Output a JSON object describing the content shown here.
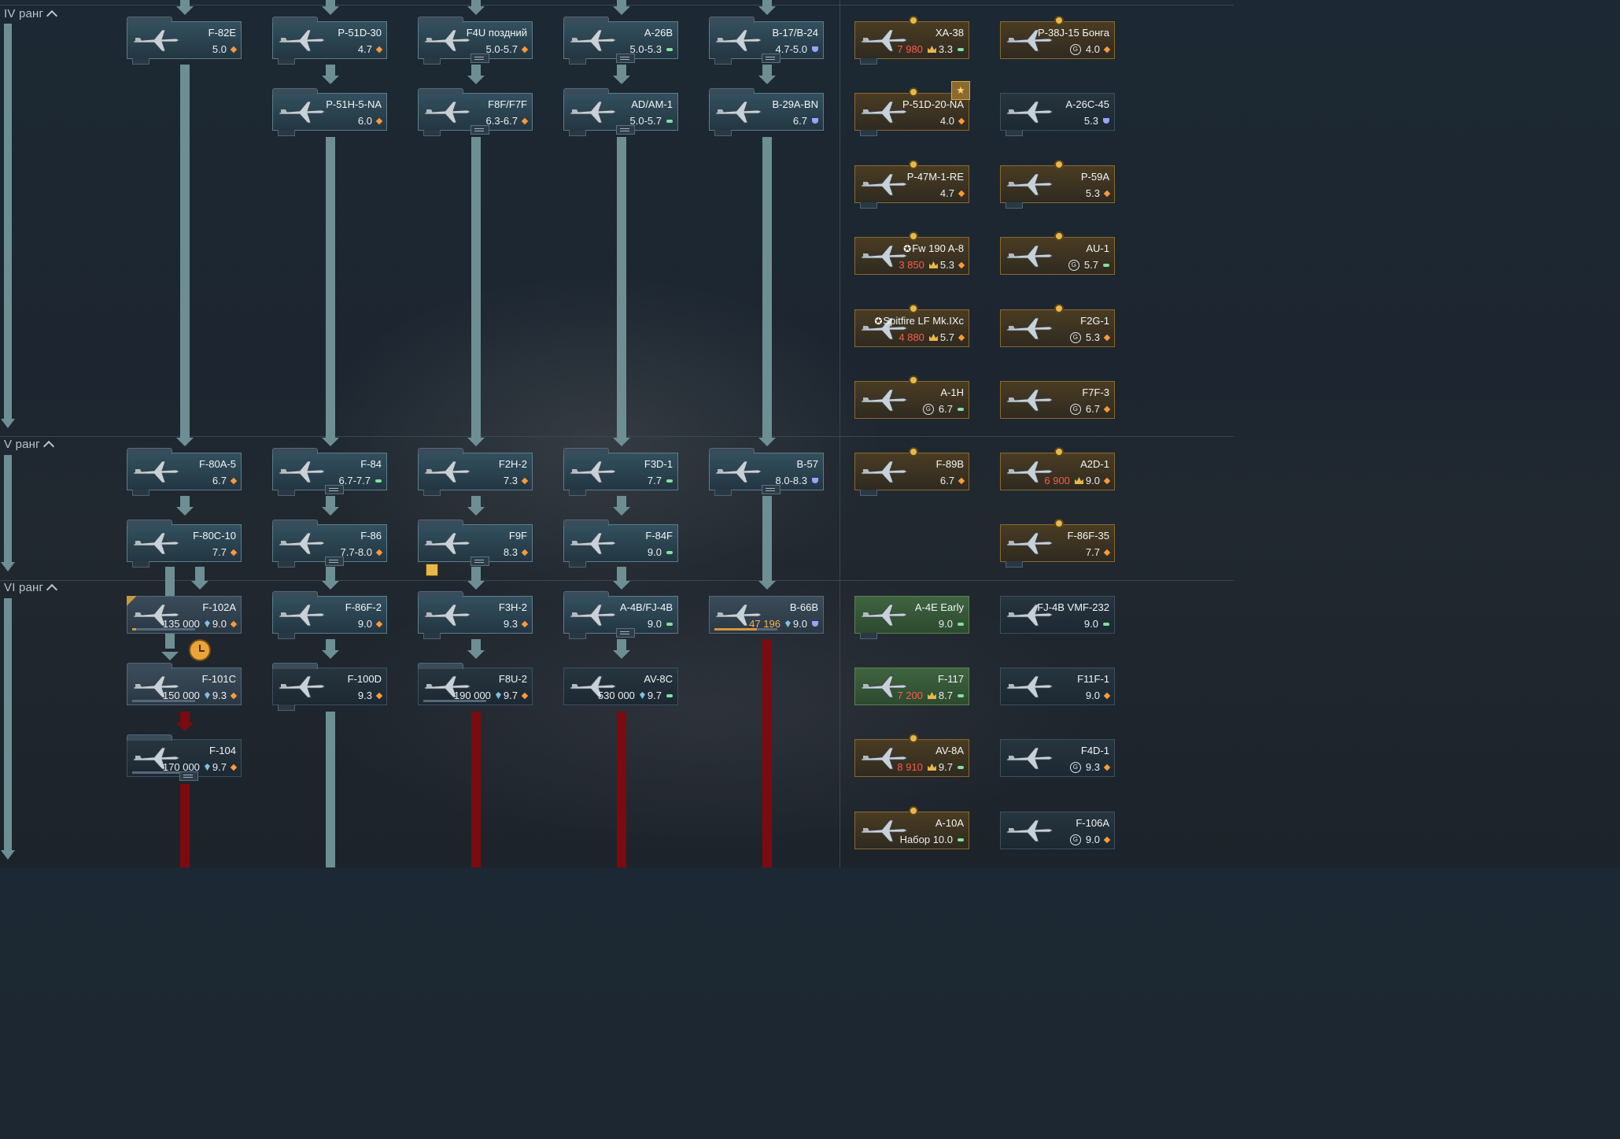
{
  "ranks": [
    {
      "id": "iv",
      "label": "IV ранг"
    },
    {
      "id": "v",
      "label": "V ранг"
    },
    {
      "id": "vi",
      "label": "VI ранг"
    }
  ],
  "colors": {
    "line": "#6d8f94",
    "red_line": "#7b0b10",
    "premium": "#e9b84a",
    "br_orange": "#ff9a3a",
    "br_green": "#7fe3a0",
    "br_blue": "#9aa3ff"
  },
  "cards": {
    "f82e": {
      "name": "F-82E",
      "br": "5.0",
      "mode_icon": "diamond-orange"
    },
    "p51d30": {
      "name": "P-51D-30",
      "br": "4.7",
      "mode_icon": "diamond-orange"
    },
    "f4u": {
      "name": "F4U поздний",
      "br": "5.0-5.7",
      "mode_icon": "diamond-orange"
    },
    "a26b": {
      "name": "A-26B",
      "br": "5.0-5.3",
      "mode_icon": "strike-green"
    },
    "b17": {
      "name": "B-17/B-24",
      "br": "4.7-5.0",
      "mode_icon": "bomber-blue"
    },
    "xa38": {
      "name": "XA-38",
      "price": "7 980",
      "br": "3.3",
      "mode_icon": "strike-green"
    },
    "p38j": {
      "name": "P-38J-15 Бонга",
      "br": "4.0",
      "mode_icon": "diamond-orange"
    },
    "p51h": {
      "name": "P-51H-5-NA",
      "br": "6.0",
      "mode_icon": "diamond-orange"
    },
    "f8f": {
      "name": "F8F/F7F",
      "br": "6.3-6.7",
      "mode_icon": "diamond-orange"
    },
    "ad1": {
      "name": "AD/AM-1",
      "br": "5.0-5.7",
      "mode_icon": "strike-green"
    },
    "b29": {
      "name": "B-29A-BN",
      "br": "6.7",
      "mode_icon": "bomber-blue"
    },
    "p51d20": {
      "name": "P-51D-20-NA",
      "br": "4.0",
      "mode_icon": "diamond-orange"
    },
    "a26c": {
      "name": "A-26C-45",
      "br": "5.3",
      "mode_icon": "bomber-blue"
    },
    "p47m": {
      "name": "P-47M-1-RE",
      "br": "4.7",
      "mode_icon": "diamond-orange"
    },
    "p59a": {
      "name": "P-59A",
      "br": "5.3",
      "mode_icon": "diamond-orange"
    },
    "fw190": {
      "name": "Fw 190 A-8",
      "price": "3 850",
      "br": "5.3",
      "mode_icon": "diamond-orange"
    },
    "au1": {
      "name": "AU-1",
      "br": "5.7",
      "mode_icon": "strike-green"
    },
    "spit": {
      "name": "Spitfire LF Mk.IXc",
      "price": "4 880",
      "br": "5.7",
      "mode_icon": "diamond-orange"
    },
    "f2g": {
      "name": "F2G-1",
      "br": "5.3",
      "mode_icon": "diamond-orange"
    },
    "a1h": {
      "name": "A-1H",
      "br": "6.7",
      "mode_icon": "strike-green"
    },
    "f7f3": {
      "name": "F7F-3",
      "br": "6.7",
      "mode_icon": "diamond-orange"
    },
    "f80a": {
      "name": "F-80A-5",
      "br": "6.7",
      "mode_icon": "diamond-orange"
    },
    "f84": {
      "name": "F-84",
      "br": "6.7-7.7",
      "mode_icon": "strike-green"
    },
    "f2h": {
      "name": "F2H-2",
      "br": "7.3",
      "mode_icon": "diamond-orange"
    },
    "f3d": {
      "name": "F3D-1",
      "br": "7.7",
      "mode_icon": "strike-green"
    },
    "b57": {
      "name": "B-57",
      "br": "8.0-8.3",
      "mode_icon": "bomber-blue"
    },
    "f89b": {
      "name": "F-89B",
      "br": "6.7",
      "mode_icon": "diamond-orange"
    },
    "a2d": {
      "name": "A2D-1",
      "price": "6 900",
      "br": "9.0",
      "mode_icon": "diamond-orange"
    },
    "f80c": {
      "name": "F-80C-10",
      "br": "7.7",
      "mode_icon": "diamond-orange"
    },
    "f86": {
      "name": "F-86",
      "br": "7.7-8.0",
      "mode_icon": "diamond-orange"
    },
    "f9f": {
      "name": "F9F",
      "br": "8.3",
      "mode_icon": "diamond-orange"
    },
    "f84f": {
      "name": "F-84F",
      "br": "9.0",
      "mode_icon": "strike-green"
    },
    "f86f35": {
      "name": "F-86F-35",
      "br": "7.7",
      "mode_icon": "diamond-orange"
    },
    "f102": {
      "name": "F-102A",
      "rp": "135 000",
      "br": "9.0",
      "mode_icon": "diamond-orange"
    },
    "f86f2": {
      "name": "F-86F-2",
      "br": "9.0",
      "mode_icon": "diamond-orange"
    },
    "f3h": {
      "name": "F3H-2",
      "br": "9.3",
      "mode_icon": "diamond-orange"
    },
    "a4b": {
      "name": "A-4B/FJ-4B",
      "br": "9.0",
      "mode_icon": "strike-green"
    },
    "b66": {
      "name": "B-66B",
      "rp": "47 196",
      "br": "9.0",
      "mode_icon": "bomber-blue"
    },
    "a4e": {
      "name": "A-4E Early",
      "br": "9.0",
      "mode_icon": "strike-green"
    },
    "fj4b": {
      "name": "FJ-4B VMF-232",
      "br": "9.0",
      "mode_icon": "strike-green"
    },
    "f101": {
      "name": "F-101C",
      "rp": "150 000",
      "br": "9.3",
      "mode_icon": "diamond-orange"
    },
    "f100": {
      "name": "F-100D",
      "br": "9.3",
      "mode_icon": "diamond-orange"
    },
    "f8u": {
      "name": "F8U-2",
      "rp": "190 000",
      "br": "9.7",
      "mode_icon": "diamond-orange"
    },
    "av8c": {
      "name": "AV-8C",
      "rp": "530 000",
      "br": "9.7",
      "mode_icon": "strike-green"
    },
    "f117": {
      "name": "F-117",
      "price": "7 200",
      "br": "8.7",
      "mode_icon": "strike-green"
    },
    "f11f": {
      "name": "F11F-1",
      "br": "9.0",
      "mode_icon": "diamond-orange"
    },
    "f104": {
      "name": "F-104",
      "rp": "170 000",
      "br": "9.7",
      "mode_icon": "diamond-orange"
    },
    "av8a": {
      "name": "AV-8A",
      "price": "8 910",
      "br": "9.7",
      "mode_icon": "strike-green"
    },
    "f4d": {
      "name": "F4D-1",
      "br": "9.3",
      "mode_icon": "diamond-orange"
    },
    "a10a": {
      "name": "A-10A",
      "br": "Набор 10.0",
      "mode_icon": "strike-green"
    },
    "f106": {
      "name": "F-106A",
      "br": "9.0",
      "mode_icon": "diamond-orange"
    }
  }
}
